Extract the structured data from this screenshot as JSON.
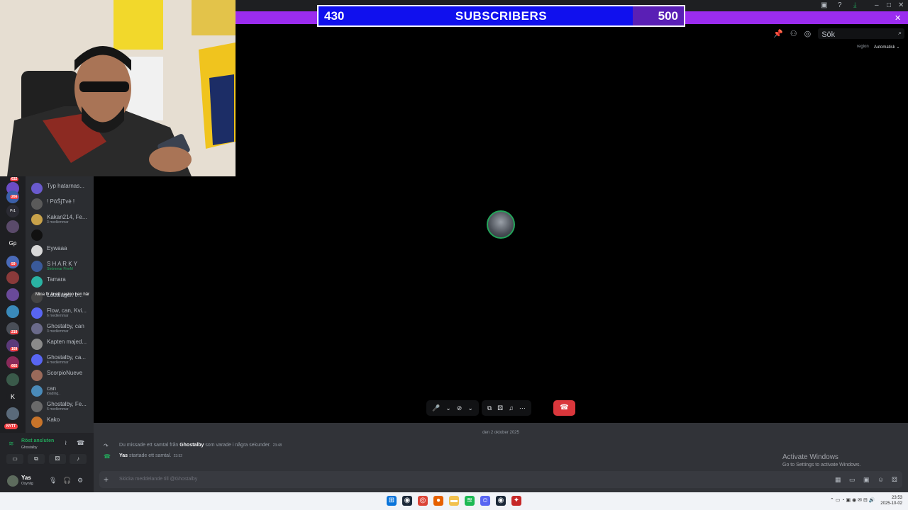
{
  "subscriber_goal": {
    "current": "430",
    "label": "SUBSCRIBERS",
    "goal": "500",
    "progress": 0.86
  },
  "header": {
    "search_placeholder": "Sök",
    "region_label": "region",
    "region_value": "Automatisk"
  },
  "guild_badges": [
    "632",
    "266",
    "Pr1",
    "Gp",
    "59",
    "210",
    "169",
    "665",
    "K",
    "NYTT"
  ],
  "dm_list": [
    {
      "name": "Typ hatarnas...",
      "sub": ""
    },
    {
      "name": "! PöŠjTvè !",
      "sub": ""
    },
    {
      "name": "Kakan214, Fe...",
      "sub": "3 medlemmar"
    },
    {
      "name": "",
      "sub": ""
    },
    {
      "name": "Eywaaa",
      "sub": ""
    },
    {
      "name": "S H A R K Y",
      "sub": "Strömmar FiveM"
    },
    {
      "name": "Tamara",
      "sub": ""
    },
    {
      "name": "Lottalager. tr...",
      "sub": ""
    },
    {
      "name": "Flow, can, Kvi...",
      "sub": "6 medlemmar"
    },
    {
      "name": "Ghostalby, can",
      "sub": "3 medlemmar"
    },
    {
      "name": "Kapten majed...",
      "sub": ""
    },
    {
      "name": "Ghostalby, ca...",
      "sub": "4 medlemmar"
    },
    {
      "name": "ScorpioNueve",
      "sub": ""
    },
    {
      "name": "can",
      "sub": "loading.."
    },
    {
      "name": "Ghostalby, Fe...",
      "sub": "6 medlemmar"
    },
    {
      "name": "Kako",
      "sub": ""
    }
  ],
  "overlap_text": "Mina flr är ett casino han här",
  "voice": {
    "status": "Röst ansluten",
    "channel": "Ghostalby"
  },
  "user": {
    "name": "Yas",
    "status": "Osynlig"
  },
  "chat": {
    "date": "den 2 oktober 2025",
    "messages": [
      {
        "pre": "Du missade ett samtal från ",
        "bold": "Ghostalby",
        "post": " som varade i några sekunder.",
        "time": "23:48"
      },
      {
        "pre": "",
        "bold": "Yas",
        "post": " startade ett samtal.",
        "time": "23:52"
      }
    ],
    "placeholder": "Skicka meddelande till @Ghostalby"
  },
  "watermark": {
    "title": "Activate Windows",
    "subtitle": "Go to Settings to activate Windows."
  },
  "clock": {
    "time": "23:53",
    "date": "2025-10-02"
  },
  "colors": {
    "purple": "#9b2cf0",
    "bar_blue": "#1010ee",
    "hangup_red": "#da373c",
    "online_green": "#23a55a"
  }
}
